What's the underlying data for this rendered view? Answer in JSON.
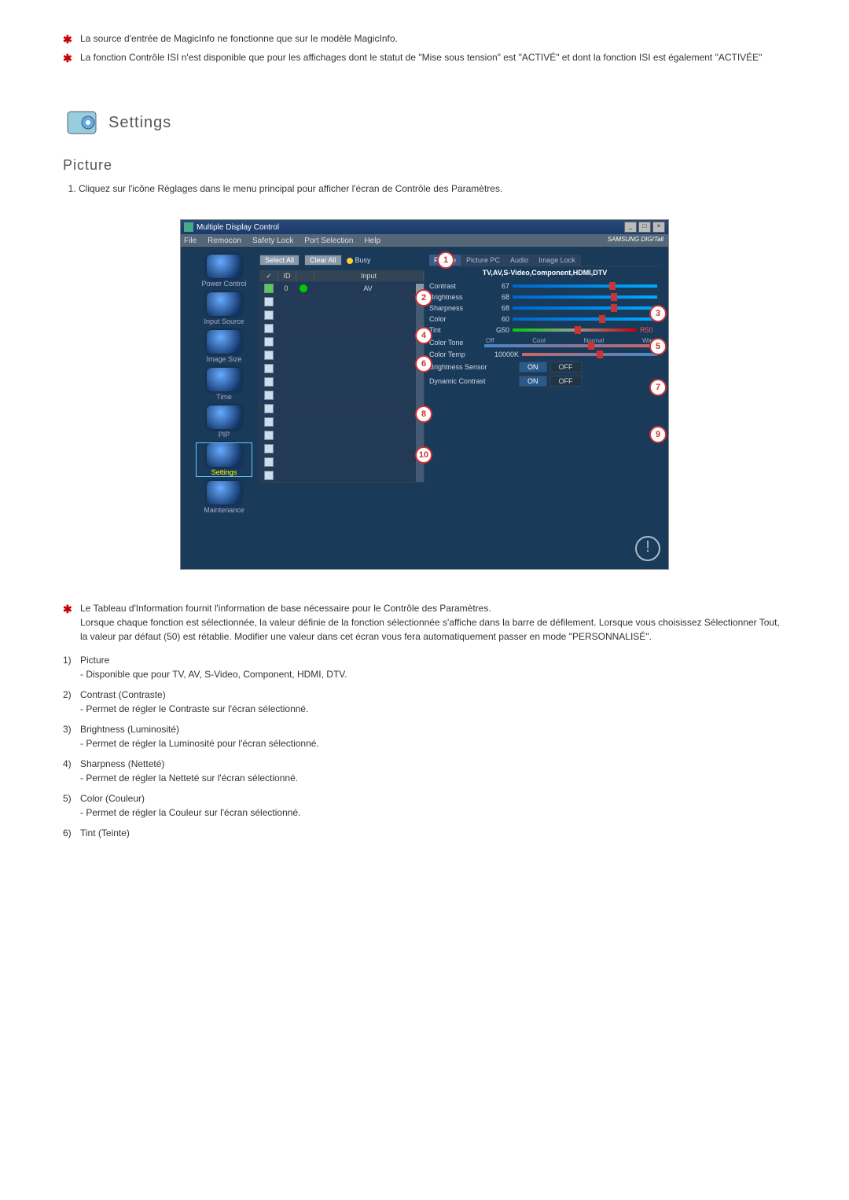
{
  "top_notes": [
    "La source d'entrée de MagicInfo ne fonctionne que sur le modèle MagicInfo.",
    "La fonction Contrôle ISI n'est disponible que pour les affichages dont le statut de \"Mise sous tension\" est \"ACTIVÉ\" et dont la fonction ISI est également \"ACTIVÉE\""
  ],
  "section_title": "Settings",
  "sub_title": "Picture",
  "main_step": "Cliquez sur l'icône Réglages dans le menu principal pour afficher l'écran de Contrôle des Paramètres.",
  "win": {
    "title": "Multiple Display Control",
    "menu": [
      "File",
      "Remocon",
      "Safety Lock",
      "Port Selection",
      "Help"
    ],
    "brand": "SAMSUNG DIGITall",
    "btn_select_all": "Select All",
    "btn_clear_all": "Clear All",
    "busy": "Busy",
    "nav": [
      {
        "label": "Power Control"
      },
      {
        "label": "Input Source"
      },
      {
        "label": "Image Size"
      },
      {
        "label": "Time"
      },
      {
        "label": "PIP"
      },
      {
        "label": "Settings"
      },
      {
        "label": "Maintenance"
      }
    ],
    "grid_headers": {
      "c1": "✓",
      "c2": "ID",
      "c3": "",
      "c4": "Input"
    },
    "grid_row": {
      "id": "0",
      "input": "AV"
    },
    "tabs": [
      "Picture",
      "Picture PC",
      "Audio",
      "Image Lock"
    ],
    "tab_sub": "TV,AV,S-Video,Component,HDMI,DTV",
    "rows": {
      "contrast": {
        "lbl": "Contrast",
        "val": "67"
      },
      "brightness": {
        "lbl": "Brightness",
        "val": "68"
      },
      "sharpness": {
        "lbl": "Sharpness",
        "val": "68"
      },
      "color": {
        "lbl": "Color",
        "val": "60"
      },
      "tint": {
        "lbl": "Tint",
        "g": "G50",
        "r": "R50"
      },
      "colortone": {
        "lbl": "Color Tone",
        "opts": [
          "Off",
          "Cool",
          "Normal",
          "Warm"
        ]
      },
      "colortemp": {
        "lbl": "Color Temp",
        "val": "10000K"
      },
      "brightsens": {
        "lbl": "Brightness Sensor",
        "on": "ON",
        "off": "OFF"
      },
      "dyncontrast": {
        "lbl": "Dynamic Contrast",
        "on": "ON",
        "off": "OFF"
      }
    }
  },
  "info_star": "Le Tableau d'Information fournit l'information de base nécessaire pour le Contrôle des Paramètres.",
  "info_body": "Lorsque chaque fonction est sélectionnée, la valeur définie de la fonction sélectionnée s'affiche dans la barre de défilement. Lorsque vous choisissez Sélectionner Tout, la valeur par défaut (50) est rétablie. Modifier une valeur dans cet écran vous fera automatiquement passer en mode \"PERSONNALISÉ\".",
  "numbered": [
    {
      "n": "1)",
      "t": "Picture",
      "d": "- Disponible que pour TV, AV, S-Video, Component, HDMI, DTV."
    },
    {
      "n": "2)",
      "t": "Contrast (Contraste)",
      "d": "- Permet de régler le Contraste sur l'écran sélectionné."
    },
    {
      "n": "3)",
      "t": "Brightness (Luminosité)",
      "d": "- Permet de régler la Luminosité pour l'écran sélectionné."
    },
    {
      "n": "4)",
      "t": "Sharpness (Netteté)",
      "d": "- Permet de régler la Netteté sur l'écran sélectionné."
    },
    {
      "n": "5)",
      "t": "Color (Couleur)",
      "d": "- Permet de régler la Couleur sur l'écran sélectionné."
    },
    {
      "n": "6)",
      "t": "Tint (Teinte)",
      "d": ""
    }
  ]
}
